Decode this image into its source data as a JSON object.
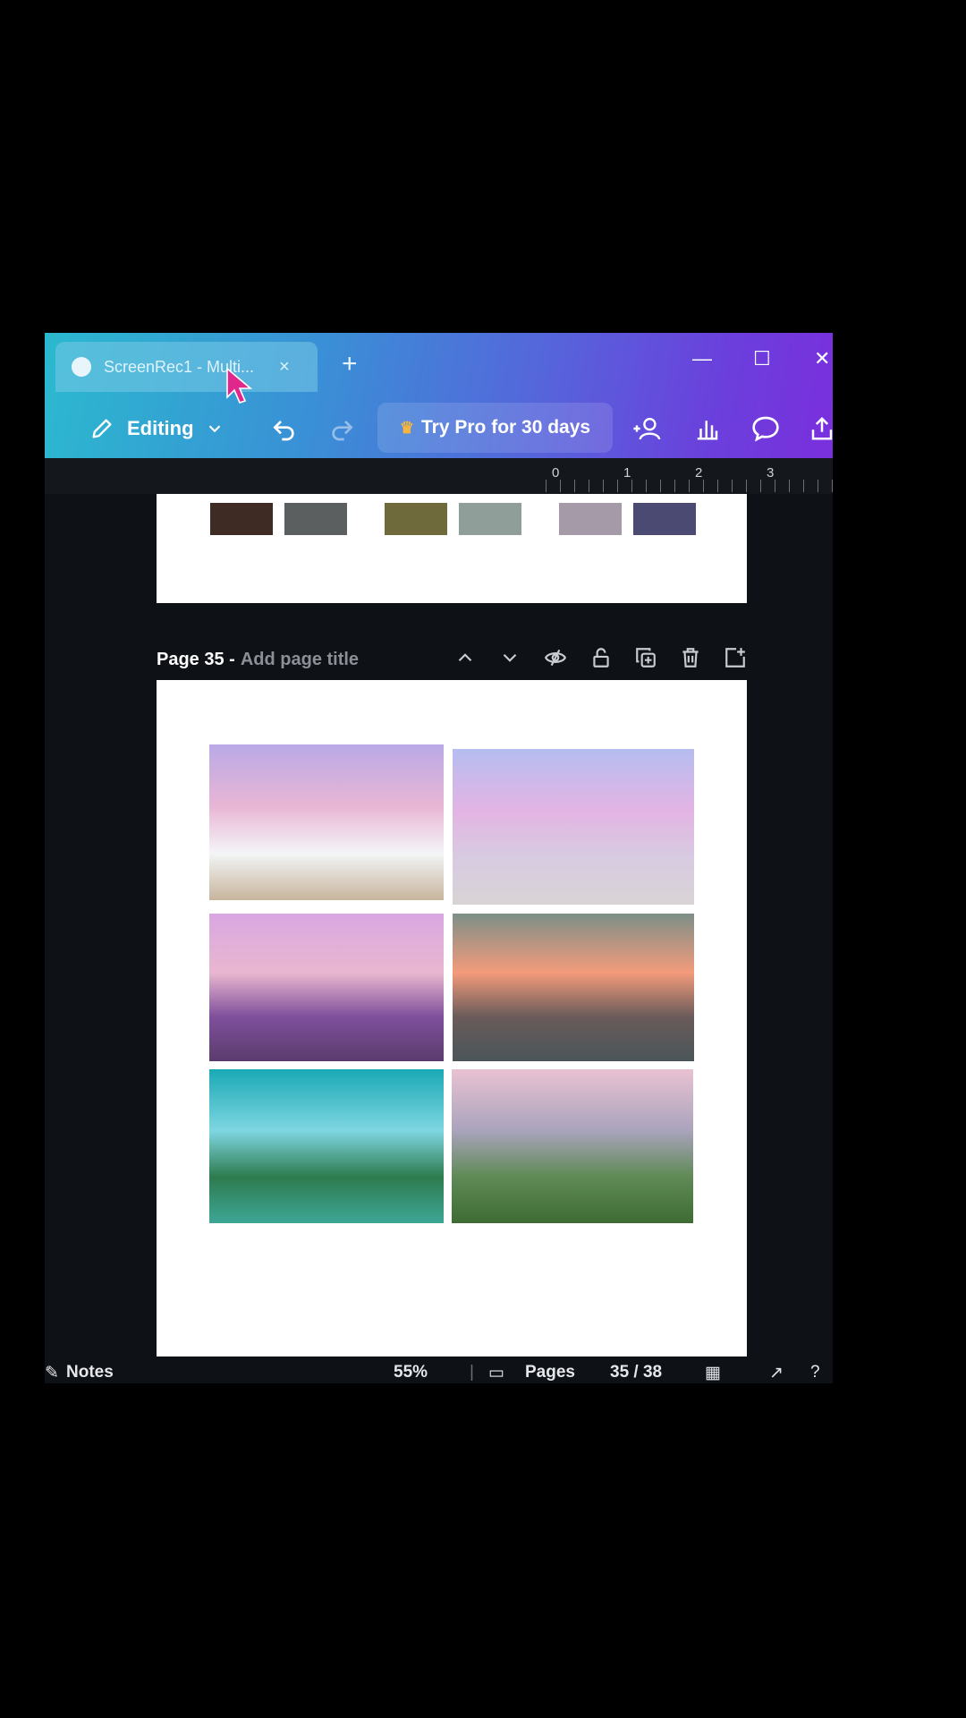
{
  "browser": {
    "tab_title": "ScreenRec1 - Multi...",
    "tab_close": "×",
    "new_tab": "+",
    "window_controls": [
      "—",
      "☐",
      "✕"
    ]
  },
  "toolbar": {
    "editing_label": "Editing",
    "try_pro_label": "Try Pro for 30 days",
    "icons": [
      "pencil-icon",
      "chevron-down-icon",
      "undo-icon",
      "redo-icon",
      "crown-icon",
      "share-people-icon",
      "insights-icon",
      "comment-icon",
      "upload-icon"
    ]
  },
  "ruler": {
    "marks": [
      "0",
      "1",
      "2",
      "3"
    ]
  },
  "previous_page": {
    "swatches": [
      "#3d2b24",
      "#5c5f60",
      "#6f6a3c",
      "#8f9e98",
      "#a59aa8",
      "#4a4a72"
    ]
  },
  "page": {
    "number_label": "Page 35 -",
    "title_placeholder": "Add page title",
    "photos": [
      {
        "desc": "purple sky rocky beach",
        "colors": [
          "#b9a9e6",
          "#e9b6d5",
          "#f3f5f7",
          "#c7b59d"
        ]
      },
      {
        "desc": "pastel sunrise sea",
        "colors": [
          "#b6bdf0",
          "#e3b4e3",
          "#d7cbe1",
          "#d9d3d5"
        ]
      },
      {
        "desc": "lavender field sunset",
        "colors": [
          "#d9a7e1",
          "#e9b7cf",
          "#7f4f9c",
          "#5b3c6d"
        ]
      },
      {
        "desc": "orange sky islands",
        "colors": [
          "#7d8f88",
          "#f39b7b",
          "#6a5b5a",
          "#4b5559"
        ]
      },
      {
        "desc": "green lake boat",
        "colors": [
          "#1aa9b5",
          "#7ed6e1",
          "#2d7b4e",
          "#3ea696"
        ]
      },
      {
        "desc": "forest mountain pink sky",
        "colors": [
          "#e9c2d2",
          "#a9a3bc",
          "#5f8a55",
          "#3e6a33"
        ]
      }
    ]
  },
  "statusbar": {
    "notes_label": "Notes",
    "zoom": "55%",
    "pages_label": "Pages",
    "page_count": "35 / 38"
  }
}
